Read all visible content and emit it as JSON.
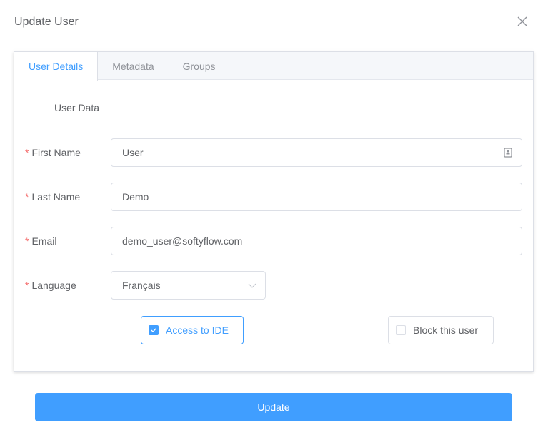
{
  "dialog": {
    "title": "Update User",
    "close_icon": "close-icon"
  },
  "tabs": [
    {
      "label": "User Details",
      "active": true
    },
    {
      "label": "Metadata",
      "active": false
    },
    {
      "label": "Groups",
      "active": false
    }
  ],
  "section": {
    "divider_label": "User Data"
  },
  "form": {
    "required_mark": "*",
    "first_name": {
      "label": "First Name",
      "value": "User",
      "icon": "contact-card-icon"
    },
    "last_name": {
      "label": "Last Name",
      "value": "Demo"
    },
    "email": {
      "label": "Email",
      "value": "demo_user@softyflow.com"
    },
    "language": {
      "label": "Language",
      "value": "Français",
      "icon": "chevron-down-icon"
    },
    "access_ide": {
      "label": "Access to IDE",
      "checked": true
    },
    "block_user": {
      "label": "Block this user",
      "checked": false
    }
  },
  "actions": {
    "update_label": "Update"
  },
  "colors": {
    "primary": "#409eff",
    "required": "#f56c6c",
    "text": "#606266",
    "border": "#dcdfe6"
  }
}
